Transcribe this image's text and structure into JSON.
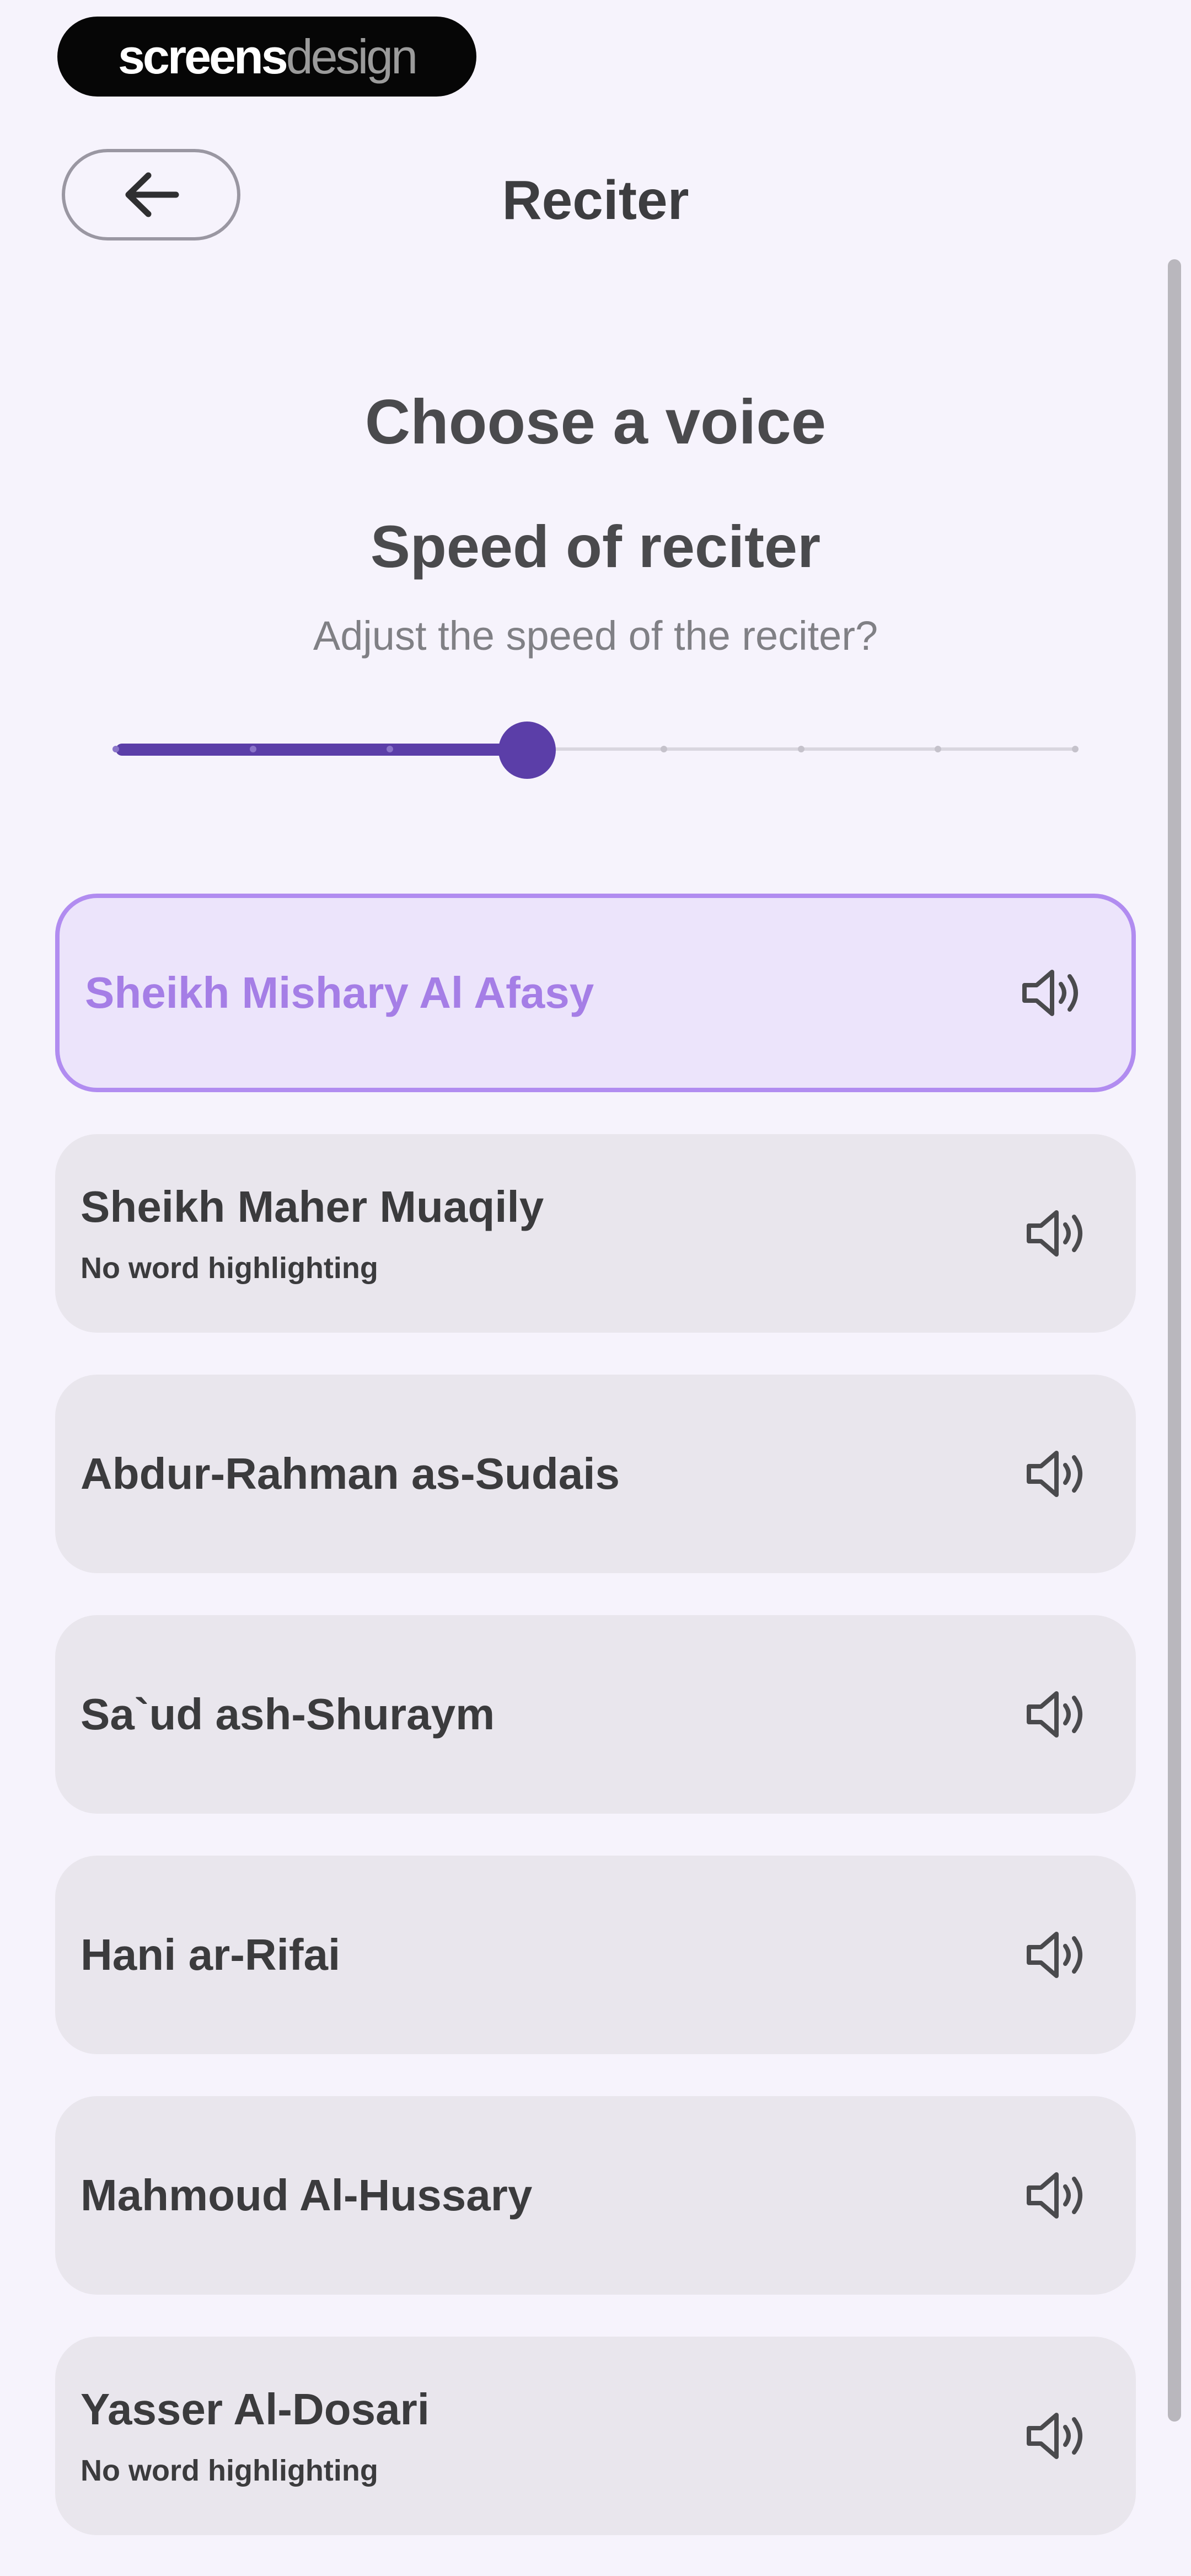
{
  "brand": {
    "part1": "screens",
    "part2": "design"
  },
  "header": {
    "title": "Reciter",
    "back_icon": "arrow-left-icon"
  },
  "voice_section": {
    "heading": "Choose a voice"
  },
  "speed": {
    "heading": "Speed of reciter",
    "subtitle": "Adjust the speed of the reciter?",
    "steps": 8,
    "value_step": 3,
    "accent": "#5b3ea8"
  },
  "reciters": [
    {
      "name": "Sheikh Mishary Al Afasy",
      "note": "",
      "selected": true,
      "icon": "speaker-icon"
    },
    {
      "name": "Sheikh Maher Muaqily",
      "note": "No word highlighting",
      "selected": false,
      "icon": "speaker-icon"
    },
    {
      "name": "Abdur-Rahman as-Sudais",
      "note": "",
      "selected": false,
      "icon": "speaker-icon"
    },
    {
      "name": "Sa`ud ash-Shuraym",
      "note": "",
      "selected": false,
      "icon": "speaker-icon"
    },
    {
      "name": "Hani ar-Rifai",
      "note": "",
      "selected": false,
      "icon": "speaker-icon"
    },
    {
      "name": "Mahmoud Al-Hussary",
      "note": "",
      "selected": false,
      "icon": "speaker-icon"
    },
    {
      "name": "Yasser Al-Dosari",
      "note": "No word highlighting",
      "selected": false,
      "icon": "speaker-icon"
    }
  ],
  "colors": {
    "selected_border": "#b18cf0",
    "selected_bg": "#ece4fb",
    "selected_text": "#a57ee6",
    "card_bg": "#e9e6ed",
    "page_bg": "#f6f3fc"
  }
}
